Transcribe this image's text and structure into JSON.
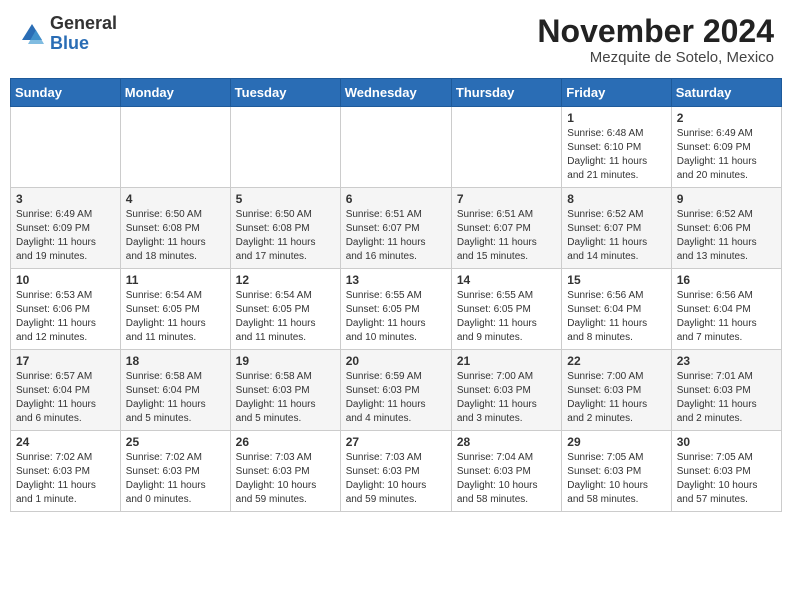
{
  "header": {
    "logo_general": "General",
    "logo_blue": "Blue",
    "month_title": "November 2024",
    "location": "Mezquite de Sotelo, Mexico"
  },
  "days_of_week": [
    "Sunday",
    "Monday",
    "Tuesday",
    "Wednesday",
    "Thursday",
    "Friday",
    "Saturday"
  ],
  "weeks": [
    [
      {
        "day": "",
        "info": ""
      },
      {
        "day": "",
        "info": ""
      },
      {
        "day": "",
        "info": ""
      },
      {
        "day": "",
        "info": ""
      },
      {
        "day": "",
        "info": ""
      },
      {
        "day": "1",
        "info": "Sunrise: 6:48 AM\nSunset: 6:10 PM\nDaylight: 11 hours\nand 21 minutes."
      },
      {
        "day": "2",
        "info": "Sunrise: 6:49 AM\nSunset: 6:09 PM\nDaylight: 11 hours\nand 20 minutes."
      }
    ],
    [
      {
        "day": "3",
        "info": "Sunrise: 6:49 AM\nSunset: 6:09 PM\nDaylight: 11 hours\nand 19 minutes."
      },
      {
        "day": "4",
        "info": "Sunrise: 6:50 AM\nSunset: 6:08 PM\nDaylight: 11 hours\nand 18 minutes."
      },
      {
        "day": "5",
        "info": "Sunrise: 6:50 AM\nSunset: 6:08 PM\nDaylight: 11 hours\nand 17 minutes."
      },
      {
        "day": "6",
        "info": "Sunrise: 6:51 AM\nSunset: 6:07 PM\nDaylight: 11 hours\nand 16 minutes."
      },
      {
        "day": "7",
        "info": "Sunrise: 6:51 AM\nSunset: 6:07 PM\nDaylight: 11 hours\nand 15 minutes."
      },
      {
        "day": "8",
        "info": "Sunrise: 6:52 AM\nSunset: 6:07 PM\nDaylight: 11 hours\nand 14 minutes."
      },
      {
        "day": "9",
        "info": "Sunrise: 6:52 AM\nSunset: 6:06 PM\nDaylight: 11 hours\nand 13 minutes."
      }
    ],
    [
      {
        "day": "10",
        "info": "Sunrise: 6:53 AM\nSunset: 6:06 PM\nDaylight: 11 hours\nand 12 minutes."
      },
      {
        "day": "11",
        "info": "Sunrise: 6:54 AM\nSunset: 6:05 PM\nDaylight: 11 hours\nand 11 minutes."
      },
      {
        "day": "12",
        "info": "Sunrise: 6:54 AM\nSunset: 6:05 PM\nDaylight: 11 hours\nand 11 minutes."
      },
      {
        "day": "13",
        "info": "Sunrise: 6:55 AM\nSunset: 6:05 PM\nDaylight: 11 hours\nand 10 minutes."
      },
      {
        "day": "14",
        "info": "Sunrise: 6:55 AM\nSunset: 6:05 PM\nDaylight: 11 hours\nand 9 minutes."
      },
      {
        "day": "15",
        "info": "Sunrise: 6:56 AM\nSunset: 6:04 PM\nDaylight: 11 hours\nand 8 minutes."
      },
      {
        "day": "16",
        "info": "Sunrise: 6:56 AM\nSunset: 6:04 PM\nDaylight: 11 hours\nand 7 minutes."
      }
    ],
    [
      {
        "day": "17",
        "info": "Sunrise: 6:57 AM\nSunset: 6:04 PM\nDaylight: 11 hours\nand 6 minutes."
      },
      {
        "day": "18",
        "info": "Sunrise: 6:58 AM\nSunset: 6:04 PM\nDaylight: 11 hours\nand 5 minutes."
      },
      {
        "day": "19",
        "info": "Sunrise: 6:58 AM\nSunset: 6:03 PM\nDaylight: 11 hours\nand 5 minutes."
      },
      {
        "day": "20",
        "info": "Sunrise: 6:59 AM\nSunset: 6:03 PM\nDaylight: 11 hours\nand 4 minutes."
      },
      {
        "day": "21",
        "info": "Sunrise: 7:00 AM\nSunset: 6:03 PM\nDaylight: 11 hours\nand 3 minutes."
      },
      {
        "day": "22",
        "info": "Sunrise: 7:00 AM\nSunset: 6:03 PM\nDaylight: 11 hours\nand 2 minutes."
      },
      {
        "day": "23",
        "info": "Sunrise: 7:01 AM\nSunset: 6:03 PM\nDaylight: 11 hours\nand 2 minutes."
      }
    ],
    [
      {
        "day": "24",
        "info": "Sunrise: 7:02 AM\nSunset: 6:03 PM\nDaylight: 11 hours\nand 1 minute."
      },
      {
        "day": "25",
        "info": "Sunrise: 7:02 AM\nSunset: 6:03 PM\nDaylight: 11 hours\nand 0 minutes."
      },
      {
        "day": "26",
        "info": "Sunrise: 7:03 AM\nSunset: 6:03 PM\nDaylight: 10 hours\nand 59 minutes."
      },
      {
        "day": "27",
        "info": "Sunrise: 7:03 AM\nSunset: 6:03 PM\nDaylight: 10 hours\nand 59 minutes."
      },
      {
        "day": "28",
        "info": "Sunrise: 7:04 AM\nSunset: 6:03 PM\nDaylight: 10 hours\nand 58 minutes."
      },
      {
        "day": "29",
        "info": "Sunrise: 7:05 AM\nSunset: 6:03 PM\nDaylight: 10 hours\nand 58 minutes."
      },
      {
        "day": "30",
        "info": "Sunrise: 7:05 AM\nSunset: 6:03 PM\nDaylight: 10 hours\nand 57 minutes."
      }
    ]
  ]
}
